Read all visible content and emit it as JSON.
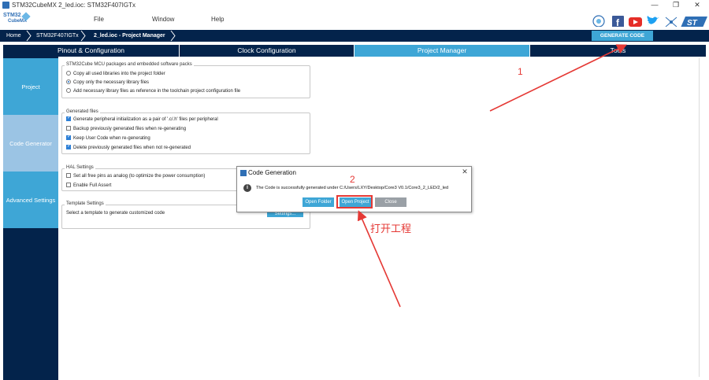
{
  "window": {
    "title": "STM32CubeMX 2_led.ioc: STM32F407IGTx",
    "minimize": "—",
    "restore": "❐",
    "close": "✕"
  },
  "logo": {
    "line1": "STM32",
    "line2": "CubeMX"
  },
  "menu": {
    "file": "File",
    "window": "Window",
    "help": "Help"
  },
  "breadcrumb": {
    "home": "Home",
    "mcu": "STM32F407IGTx",
    "current": "2_led.ioc - Project Manager"
  },
  "toolbar": {
    "generate_code": "GENERATE CODE"
  },
  "tabs": [
    {
      "label": "Pinout & Configuration"
    },
    {
      "label": "Clock Configuration"
    },
    {
      "label": "Project Manager"
    },
    {
      "label": "Tools"
    }
  ],
  "sidebar": {
    "items": [
      {
        "label": "Project"
      },
      {
        "label": "Code Generator"
      },
      {
        "label": "Advanced Settings"
      }
    ]
  },
  "packages_group": {
    "title": "STM32Cube MCU packages and embedded software packs",
    "options": [
      {
        "label": "Copy all used libraries into the project folder",
        "selected": false
      },
      {
        "label": "Copy only the necessary library files",
        "selected": true
      },
      {
        "label": "Add necessary library files as reference in the toolchain project configuration file",
        "selected": false
      }
    ]
  },
  "generated_group": {
    "title": "Generated files",
    "options": [
      {
        "label": "Generate peripheral initialization as a pair of '.c/.h' files per peripheral",
        "checked": true
      },
      {
        "label": "Backup previously generated files when re-generating",
        "checked": false
      },
      {
        "label": "Keep User Code when re-generating",
        "checked": true
      },
      {
        "label": "Delete previously generated files when not re-generated",
        "checked": true
      }
    ]
  },
  "hal_group": {
    "title": "HAL Settings",
    "options": [
      {
        "label": "Set all free pins as analog (to optimize the power consumption)",
        "checked": false
      },
      {
        "label": "Enable Full Assert",
        "checked": false
      }
    ]
  },
  "template_group": {
    "title": "Template Settings",
    "text": "Select a template to generate customized code",
    "button": "Settings..."
  },
  "dialog": {
    "title": "Code Generation",
    "message": "The Code is successfully generated under C:/Users/LXY/Desktop/Core3 V0.1/Core3_2_LED/2_led",
    "open_folder": "Open Folder",
    "open_project": "Open Project",
    "close": "Close"
  },
  "annotations": {
    "num1": "1",
    "num2": "2",
    "caption": "打开工程"
  },
  "colors": {
    "navy": "#03234b",
    "accent": "#3ea6d6",
    "annotation": "#e53935"
  }
}
